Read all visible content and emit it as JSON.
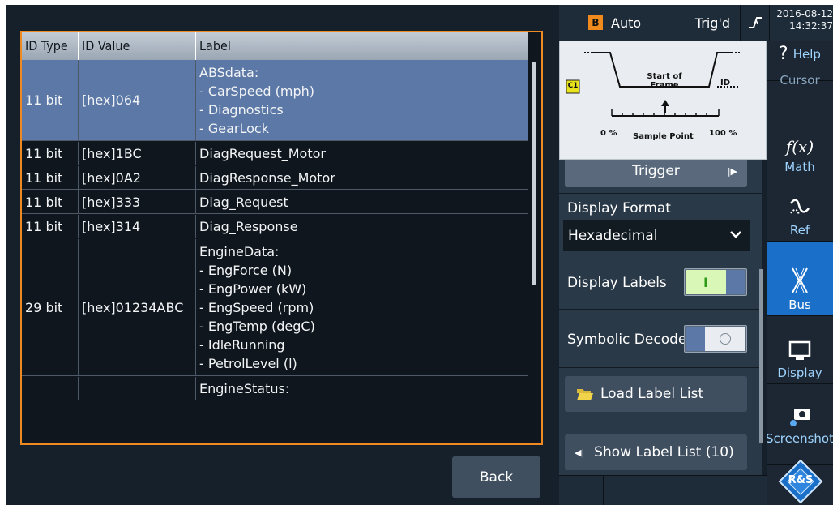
{
  "table": {
    "headers": {
      "id_type": "ID Type",
      "id_value": "ID Value",
      "label": "Label"
    },
    "rows": [
      {
        "id_type": "11 bit",
        "id_value": "[hex]064",
        "label": "ABSdata:\n- CarSpeed (mph)\n- Diagnostics\n- GearLock",
        "selected": true
      },
      {
        "id_type": "11 bit",
        "id_value": "[hex]1BC",
        "label": "DiagRequest_Motor"
      },
      {
        "id_type": "11 bit",
        "id_value": "[hex]0A2",
        "label": "DiagResponse_Motor"
      },
      {
        "id_type": "11 bit",
        "id_value": "[hex]333",
        "label": "Diag_Request"
      },
      {
        "id_type": "11 bit",
        "id_value": "[hex]314",
        "label": "Diag_Response"
      },
      {
        "id_type": "29 bit",
        "id_value": "[hex]01234ABC",
        "label": "EngineData:\n- EngForce (N)\n- EngPower (kW)\n- EngSpeed (rpm)\n- EngTemp (degC)\n- IdleRunning\n- PetrolLevel (l)"
      },
      {
        "id_type": "",
        "id_value": "",
        "label": "EngineStatus:"
      }
    ]
  },
  "back_label": "Back",
  "status": {
    "channel_badge": "B",
    "mode": "Auto",
    "trigger_state": "Trig'd",
    "date": "2016-08-12",
    "time": "14:32:37"
  },
  "diagram": {
    "badge": "C1",
    "start_of_frame": "Start of\nFrame",
    "id": "ID",
    "pct_left": "0 %",
    "sample_point": "Sample Point",
    "pct_right": "100 %"
  },
  "panel": {
    "trigger_label": "Trigger",
    "display_format_label": "Display Format",
    "display_format_value": "Hexadecimal",
    "display_labels_label": "Display Labels",
    "display_labels_on": "I",
    "symbolic_decode_label": "Symbolic Decode",
    "load_label_list": "Load Label List",
    "show_label_list": "Show Label List (10)"
  },
  "sidebar": {
    "help": "Help",
    "cursor": "Cursor",
    "math": "Math",
    "ref": "Ref",
    "bus": "Bus",
    "display": "Display",
    "screenshot": "Screenshot",
    "brand_letters": "R&S"
  },
  "colors": {
    "accent_orange": "#ef8a22",
    "selection_blue": "#5b78a6",
    "active_blue": "#1a6fc9",
    "toggle_on_green": "#2f9a18"
  }
}
